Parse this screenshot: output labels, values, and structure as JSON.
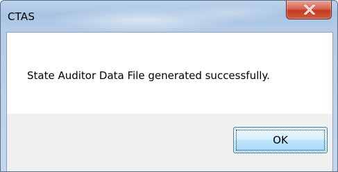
{
  "window": {
    "title": "CTAS",
    "close_icon": "close-icon"
  },
  "dialog": {
    "message": "State Auditor Data File generated successfully.",
    "ok_label": "OK"
  },
  "colors": {
    "close_button": "#c23a22",
    "ok_button_border": "#3c7fb1",
    "frame": "#b5cde8"
  }
}
